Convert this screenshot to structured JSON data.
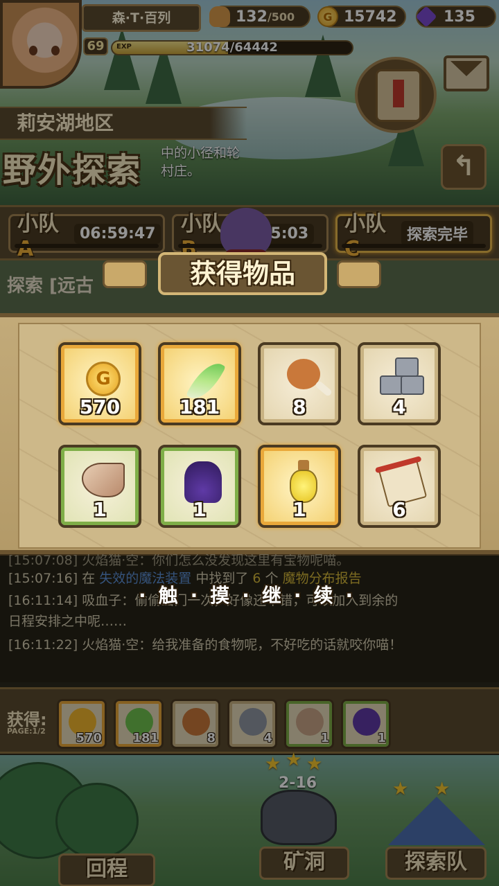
{
  "player": {
    "name": "森·T·百列",
    "level": "69",
    "exp_tag": "EXP",
    "exp_text": "31074/64442",
    "exp_fraction": 0.482
  },
  "resources": {
    "bread": {
      "value": "132",
      "max": "/500",
      "icon": "bread-icon"
    },
    "gold": {
      "value": "15742",
      "icon": "gold-coin-icon",
      "glyph": "G"
    },
    "gem": {
      "value": "135",
      "icon": "purple-gem-icon"
    }
  },
  "region": {
    "name": "莉安湖地区",
    "title": "野外探索",
    "desc_line1": "中的小径和轮",
    "desc_line2": "村庄。"
  },
  "squads": [
    {
      "letter_prefix": "小队",
      "letter": "A",
      "status": "06:59:47"
    },
    {
      "letter_prefix": "小队",
      "letter": "B",
      "status": "1:25:03"
    },
    {
      "letter_prefix": "小队",
      "letter": "C",
      "status": "探索完毕"
    }
  ],
  "explore_line": "探索 [远古",
  "modal": {
    "title": "获得物品",
    "items": [
      {
        "icon": "gold-coin-icon",
        "count": "570",
        "rarity": "gold"
      },
      {
        "icon": "green-feather-icon",
        "count": "181",
        "rarity": "gold"
      },
      {
        "icon": "drumstick-icon",
        "count": "8",
        "rarity": "plain"
      },
      {
        "icon": "stone-blocks-icon",
        "count": "4",
        "rarity": "plain"
      },
      {
        "icon": "horn-icon",
        "count": "1",
        "rarity": "green"
      },
      {
        "icon": "purple-tentacle-icon",
        "count": "1",
        "rarity": "green"
      },
      {
        "icon": "yellow-potion-icon",
        "count": "1",
        "rarity": "gold"
      },
      {
        "icon": "scroll-report-icon",
        "count": "6",
        "rarity": "plain"
      }
    ]
  },
  "log": {
    "line0": "[15:07:08] 火焰猫·空：你们怎么没发现这里有宝物呢喵。",
    "line1_time": "[15:07:16]",
    "line1_a": " 在 ",
    "line1_place": "失效的魔法装置",
    "line1_b": " 中找到了 ",
    "line1_num": "6",
    "line1_c": " 个 ",
    "line1_item": "魔物分布报告",
    "line2": "[16:11:14] 吸血子：偷偷出门一次，好像还不错，可以加入到余的",
    "line3": "日程安排之中呢……",
    "line4": "[16:11:22] 火焰猫·空：给我准备的食物呢，不好吃的话就咬你喵！",
    "tap_continue": "·触·摸·继·续·"
  },
  "gain": {
    "label": "获得:",
    "page": "PAGE:1/2",
    "items": [
      {
        "icon": "gold-coin-icon",
        "count": "570",
        "rarity": "gold"
      },
      {
        "icon": "green-feather-icon",
        "count": "181",
        "rarity": "gold"
      },
      {
        "icon": "drumstick-icon",
        "count": "8",
        "rarity": "plain"
      },
      {
        "icon": "stone-blocks-icon",
        "count": "4",
        "rarity": "plain"
      },
      {
        "icon": "horn-icon",
        "count": "1",
        "rarity": "green"
      },
      {
        "icon": "purple-tentacle-icon",
        "count": "1",
        "rarity": "green"
      }
    ]
  },
  "buildings": {
    "return_label": "回程",
    "mine_label": "矿洞",
    "mine_level": "2-16",
    "team_label": "探索队"
  }
}
